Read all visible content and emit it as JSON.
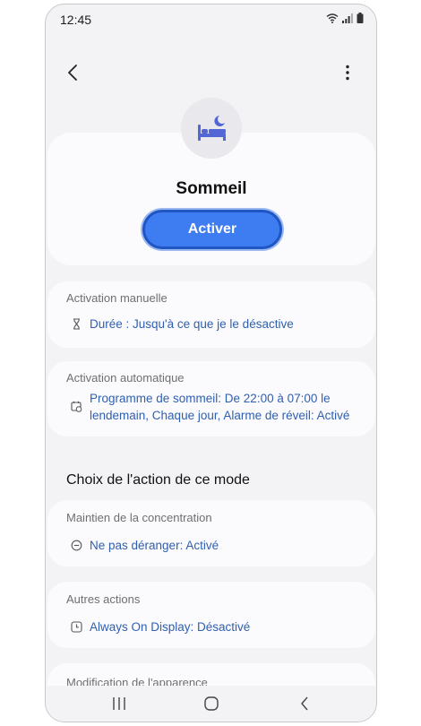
{
  "status": {
    "time": "12:45"
  },
  "mode": {
    "title": "Sommeil",
    "activate_label": "Activer"
  },
  "manual": {
    "title": "Activation manuelle",
    "duration": "Durée : Jusqu'à ce que je le désactive"
  },
  "automatic": {
    "title": "Activation automatique",
    "schedule_line1": "Programme de sommeil: De 22:00 à 07:00 le",
    "schedule_line2": "lendemain, Chaque jour, Alarme de réveil: Activé"
  },
  "actions_heading": "Choix de l'action de ce mode",
  "focus": {
    "title": "Maintien de la concentration",
    "dnd": "Ne pas déranger: Activé"
  },
  "other": {
    "title": "Autres actions",
    "aod": "Always On Display: Désactivé"
  },
  "appearance": {
    "title": "Modification de l'apparence"
  },
  "colors": {
    "accent": "#3e7cf2",
    "link": "#2f5fb0",
    "icon": "#5266d6"
  },
  "icons": [
    "wifi-icon",
    "signal-icon",
    "battery-icon",
    "back-arrow-icon",
    "more-vert-icon",
    "bed-moon-icon",
    "hourglass-icon",
    "calendar-clock-icon",
    "do-not-disturb-icon",
    "clock-icon",
    "recents-icon",
    "home-icon",
    "nav-back-icon"
  ]
}
